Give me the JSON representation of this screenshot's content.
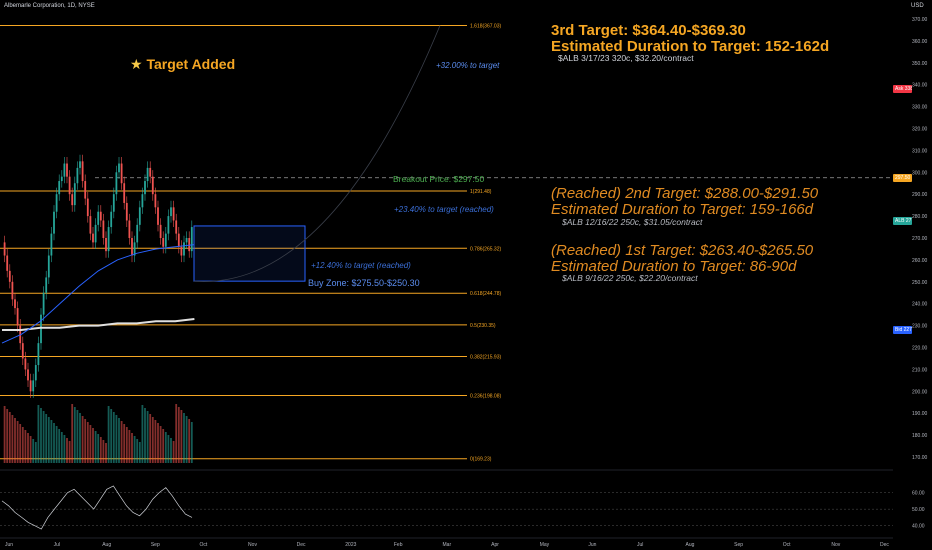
{
  "header": {
    "title": "Albemarle Corporation, 1D, NYSE"
  },
  "currency": "USD",
  "colors": {
    "background": "#000000",
    "fib": "#f5a623",
    "up": "#26a69a",
    "down": "#ef5350",
    "ma": "#2962ff",
    "rsi": "#7e57c2",
    "buy_zone": "#2962ff"
  },
  "annotations": {
    "target_added": "Target Added",
    "target_added_icon": "star-icon",
    "t3_title": "3rd Target: $364.40-$369.30",
    "t3_duration": "Estimated Duration to Target: 152-162d",
    "t3_option": "$ALB 3/17/23 320c, $32.20/contract",
    "t3_pct": "+32.00% to target",
    "breakout": "Breakout Price: $297.50",
    "t2_title": "(Reached) 2nd Target: $288.00-$291.50",
    "t2_duration": "Estimated Duration to Target: 159-166d",
    "t2_option": "$ALB 12/16/22 250c, $31.05/contract",
    "t2_pct": "+23.40% to target (reached)",
    "t1_title": "(Reached) 1st Target: $263.40-$265.50",
    "t1_duration": "Estimated Duration to Target: 86-90d",
    "t1_option": "$ALB 9/16/22 250c, $22.20/contract",
    "t1_pct": "+12.40% to target (reached)",
    "buy_zone": "Buy Zone: $275.50-$250.30"
  },
  "price_pills": [
    {
      "label": "Ask",
      "value": "338.07",
      "price": 338.07,
      "color": "#f23645"
    },
    {
      "label": "",
      "value": "297.50",
      "price": 297.5,
      "color": "#f5a623"
    },
    {
      "label": "ALB",
      "value": "277.95",
      "price": 277.95,
      "color": "#26a69a"
    },
    {
      "label": "Bid",
      "value": "227.98",
      "price": 227.98,
      "color": "#2962ff"
    }
  ],
  "chart_data": {
    "type": "line",
    "symbol": "ALB",
    "interval": "1D",
    "y_axis": {
      "ticks": [
        170,
        180,
        190,
        200,
        210,
        220,
        230,
        240,
        250,
        260,
        270,
        280,
        290,
        300,
        310,
        320,
        330,
        340,
        350,
        360,
        370
      ],
      "range": [
        165,
        375
      ]
    },
    "x_axis": {
      "ticks": [
        "Jun",
        "Jul",
        "Aug",
        "Sep",
        "Oct",
        "Nov",
        "Dec",
        "2023",
        "Feb",
        "Mar",
        "Apr",
        "May",
        "Jun",
        "Jul",
        "Aug",
        "Sep",
        "Oct",
        "Nov",
        "Dec"
      ]
    },
    "fib_levels": [
      {
        "label": "1.618(367.03)",
        "price": 367.03
      },
      {
        "label": "1(291.48)",
        "price": 291.48
      },
      {
        "label": "0.786(265.32)",
        "price": 265.32
      },
      {
        "label": "0.618(244.78)",
        "price": 244.78
      },
      {
        "label": "0.5(230.35)",
        "price": 230.35
      },
      {
        "label": "0.382(215.93)",
        "price": 215.93
      },
      {
        "label": "0.236(198.08)",
        "price": 198.08
      },
      {
        "label": "0(169.23)",
        "price": 169.23
      }
    ],
    "breakout_price": 297.5,
    "buy_zone": {
      "high": 275.5,
      "low": 250.3
    },
    "price_series": {
      "name": "ALB",
      "values": [
        268,
        262,
        255,
        250,
        242,
        238,
        230,
        222,
        215,
        210,
        205,
        200,
        205,
        212,
        222,
        235,
        245,
        252,
        262,
        272,
        282,
        290,
        296,
        298,
        304,
        298,
        290,
        285,
        295,
        302,
        305,
        296,
        288,
        280,
        272,
        268,
        276,
        282,
        278,
        270,
        264,
        275,
        282,
        290,
        300,
        304,
        295,
        286,
        278,
        270,
        262,
        268,
        276,
        284,
        290,
        296,
        302,
        298,
        290,
        284,
        276,
        270,
        266,
        272,
        280,
        284,
        278,
        272,
        266,
        262,
        268,
        270,
        264,
        275
      ]
    },
    "ma_series": [
      {
        "name": "",
        "values": [
          228,
          228,
          229,
          229,
          230,
          230,
          231,
          231,
          232,
          232,
          233
        ]
      },
      {
        "name": "",
        "values": [
          222,
          226,
          232,
          240,
          248,
          255,
          260,
          263,
          265,
          266,
          267
        ]
      }
    ],
    "rsi": {
      "ticks": [
        40,
        50,
        60
      ],
      "range": [
        35,
        70
      ],
      "values": [
        55,
        52,
        48,
        45,
        42,
        40,
        38,
        45,
        50,
        55,
        60,
        62,
        58,
        54,
        50,
        56,
        62,
        64,
        58,
        52,
        48,
        46,
        50,
        56,
        60,
        63,
        58,
        52,
        47,
        45
      ]
    }
  }
}
